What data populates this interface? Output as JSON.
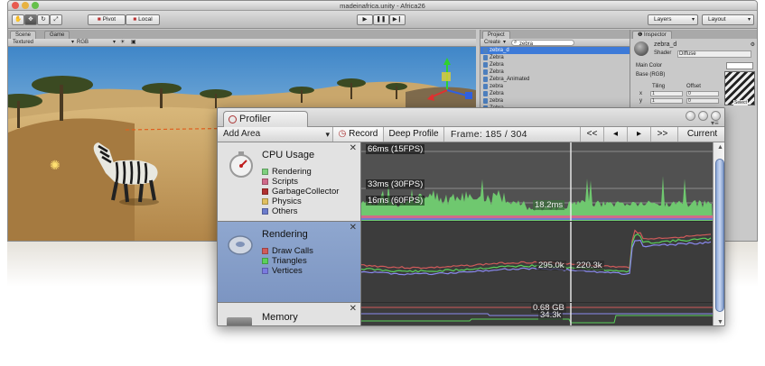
{
  "editor": {
    "title": "madeinafrica.unity - Africa26",
    "toolbar": {
      "pivot_label": "Pivot",
      "local_label": "Local",
      "layers_label": "Layers",
      "layout_label": "Layout"
    }
  },
  "scene": {
    "tab_scene": "Scene",
    "tab_game": "Game",
    "draw_mode": "Textured",
    "color_mode": "RGB"
  },
  "project": {
    "tab": "Project",
    "create_label": "Create",
    "search_value": "zebra",
    "items": [
      "zebra_d",
      "Zebra",
      "Zebra",
      "Zebra",
      "Zebra_Animated",
      "zebra",
      "Zebra",
      "zebra",
      "Zebra"
    ]
  },
  "inspector": {
    "tab": "Inspector",
    "object_name": "zebra_d",
    "shader_label": "Shader",
    "shader_value": "Diffuse",
    "main_color_label": "Main Color",
    "base_label": "Base (RGB)",
    "tiling_label": "Tiling",
    "offset_label": "Offset",
    "x_label": "x",
    "y_label": "y",
    "tiling_x": "1",
    "tiling_y": "1",
    "offset_x": "0",
    "offset_y": "0",
    "select_label": "Select"
  },
  "profiler": {
    "tab_title": "Profiler",
    "add_area": "Add Area",
    "record": "Record",
    "deep_profile": "Deep Profile",
    "frame_label": "Frame: 185 / 304",
    "nav_first": "<<",
    "nav_prev": "◂",
    "nav_next": "▸",
    "nav_last": ">>",
    "current": "Current",
    "areas": {
      "cpu": {
        "title": "CPU Usage",
        "legend": [
          {
            "name": "Rendering",
            "color": "#7ed07e"
          },
          {
            "name": "Scripts",
            "color": "#d06a8a"
          },
          {
            "name": "GarbageCollector",
            "color": "#b03030"
          },
          {
            "name": "Physics",
            "color": "#e0c060"
          },
          {
            "name": "Others",
            "color": "#6c7ccc"
          }
        ],
        "guides": [
          "66ms (15FPS)",
          "33ms (30FPS)",
          "16ms (60FPS)"
        ],
        "cursor_value": "18.2ms"
      },
      "rendering": {
        "title": "Rendering",
        "legend": [
          {
            "name": "Draw Calls",
            "color": "#d05a5a"
          },
          {
            "name": "Triangles",
            "color": "#5ad05a"
          },
          {
            "name": "Vertices",
            "color": "#7a7ae0"
          }
        ],
        "values": [
          "295.0k",
          "220.3k"
        ]
      },
      "memory": {
        "title": "Memory",
        "values": [
          "0.68 GB",
          "34.3k"
        ]
      }
    }
  }
}
